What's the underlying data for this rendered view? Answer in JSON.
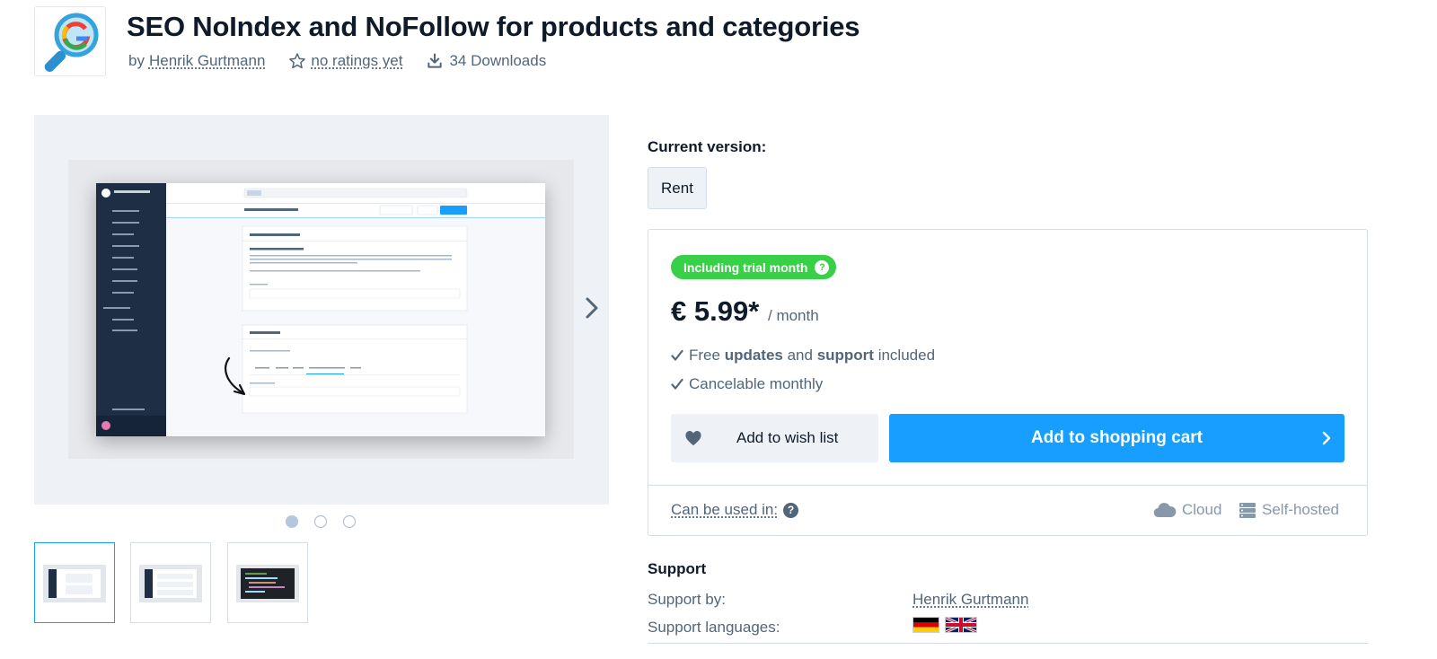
{
  "header": {
    "title": "SEO NoIndex and NoFollow for products and categories",
    "by_prefix": "by",
    "author": "Henrik Gurtmann",
    "ratings": "no ratings yet",
    "downloads": "34 Downloads"
  },
  "gallery": {
    "image_count": 3,
    "active_index": 0,
    "thumbnails": [
      "screenshot-1",
      "screenshot-2",
      "screenshot-3"
    ]
  },
  "purchase": {
    "current_version_label": "Current version:",
    "version_option": "Rent",
    "trial_badge": "Including trial month",
    "price": "€ 5.99*",
    "period": "/ month",
    "features": [
      {
        "pre": "Free ",
        "b1": "updates",
        "mid": " and ",
        "b2": "support",
        "post": " included"
      },
      {
        "pre": "Cancelable monthly"
      }
    ],
    "wishlist_label": "Add to wish list",
    "cart_label": "Add to shopping cart",
    "usable_in_label": "Can be used in:",
    "environments": [
      "Cloud",
      "Self-hosted"
    ]
  },
  "support": {
    "title": "Support",
    "by_label": "Support by:",
    "by_value": "Henrik Gurtmann",
    "languages_label": "Support languages:",
    "languages": [
      "German",
      "English"
    ]
  },
  "colors": {
    "accent": "#189eff",
    "trial_green": "#37d046",
    "text_dark": "#0f1b2a",
    "text_muted": "#52667a"
  }
}
